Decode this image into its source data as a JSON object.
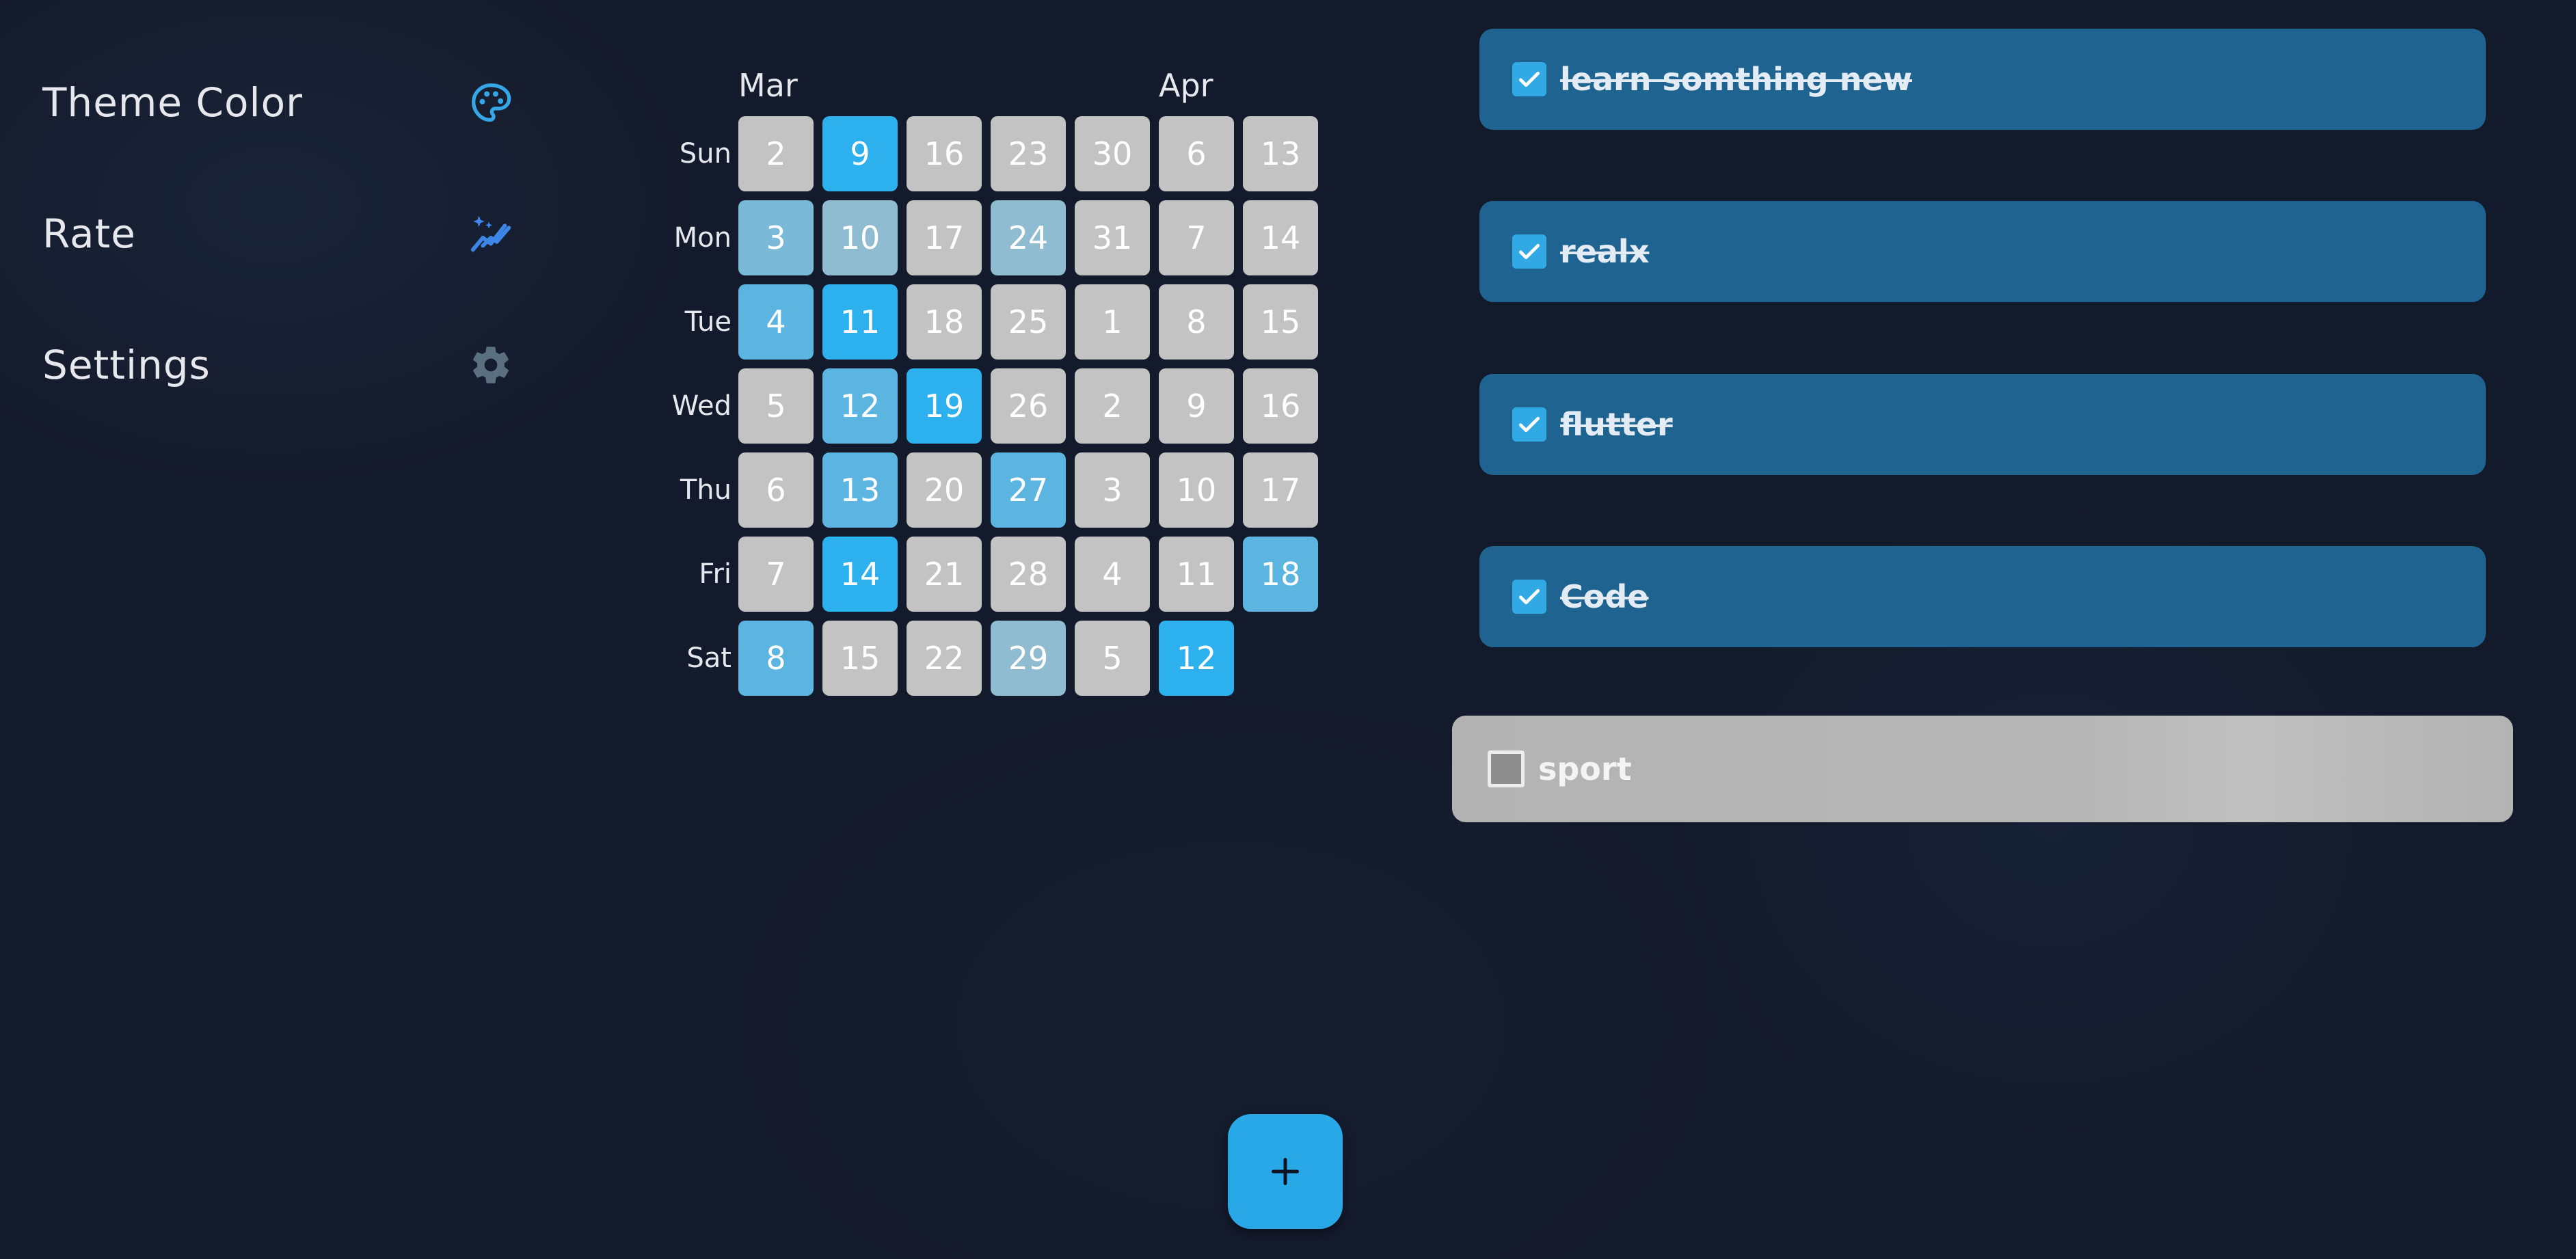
{
  "menu": {
    "items": [
      {
        "label": "Theme Color",
        "icon": "palette-icon"
      },
      {
        "label": "Rate",
        "icon": "sparkle-chart-icon"
      },
      {
        "label": "Settings",
        "icon": "gear-icon"
      }
    ]
  },
  "heatmap": {
    "months": [
      "Mar",
      "Apr"
    ],
    "weekdays": [
      "Sun",
      "Mon",
      "Tue",
      "Wed",
      "Thu",
      "Fri",
      "Sat"
    ],
    "colors": {
      "empty": "#c3c3c3",
      "l1": "#8fbcd0",
      "l2": "#7bb9d8",
      "l3": "#5cb5e0",
      "l4": "#2db1ee"
    },
    "weeks": [
      [
        {
          "d": "2",
          "l": "empty"
        },
        {
          "d": "3",
          "l": "l2"
        },
        {
          "d": "4",
          "l": "l3"
        },
        {
          "d": "5",
          "l": "empty"
        },
        {
          "d": "6",
          "l": "empty"
        },
        {
          "d": "7",
          "l": "empty"
        },
        {
          "d": "8",
          "l": "l3"
        }
      ],
      [
        {
          "d": "9",
          "l": "l4"
        },
        {
          "d": "10",
          "l": "l1"
        },
        {
          "d": "11",
          "l": "l4"
        },
        {
          "d": "12",
          "l": "l3"
        },
        {
          "d": "13",
          "l": "l3"
        },
        {
          "d": "14",
          "l": "l4"
        },
        {
          "d": "15",
          "l": "empty"
        }
      ],
      [
        {
          "d": "16",
          "l": "empty"
        },
        {
          "d": "17",
          "l": "empty"
        },
        {
          "d": "18",
          "l": "empty"
        },
        {
          "d": "19",
          "l": "l4"
        },
        {
          "d": "20",
          "l": "empty"
        },
        {
          "d": "21",
          "l": "empty"
        },
        {
          "d": "22",
          "l": "empty"
        }
      ],
      [
        {
          "d": "23",
          "l": "empty"
        },
        {
          "d": "24",
          "l": "l1"
        },
        {
          "d": "25",
          "l": "empty"
        },
        {
          "d": "26",
          "l": "empty"
        },
        {
          "d": "27",
          "l": "l3"
        },
        {
          "d": "28",
          "l": "empty"
        },
        {
          "d": "29",
          "l": "l1"
        }
      ],
      [
        {
          "d": "30",
          "l": "empty"
        },
        {
          "d": "31",
          "l": "empty"
        },
        {
          "d": "1",
          "l": "empty"
        },
        {
          "d": "2",
          "l": "empty"
        },
        {
          "d": "3",
          "l": "empty"
        },
        {
          "d": "4",
          "l": "empty"
        },
        {
          "d": "5",
          "l": "empty"
        }
      ],
      [
        {
          "d": "6",
          "l": "empty"
        },
        {
          "d": "7",
          "l": "empty"
        },
        {
          "d": "8",
          "l": "empty"
        },
        {
          "d": "9",
          "l": "empty"
        },
        {
          "d": "10",
          "l": "empty"
        },
        {
          "d": "11",
          "l": "empty"
        },
        {
          "d": "12",
          "l": "l4"
        }
      ],
      [
        {
          "d": "13",
          "l": "empty"
        },
        {
          "d": "14",
          "l": "empty"
        },
        {
          "d": "15",
          "l": "empty"
        },
        {
          "d": "16",
          "l": "empty"
        },
        {
          "d": "17",
          "l": "empty"
        },
        {
          "d": "18",
          "l": "l3"
        }
      ]
    ]
  },
  "tasks": [
    {
      "label": "learn somthing new",
      "done": true
    },
    {
      "label": "realx",
      "done": true
    },
    {
      "label": "flutter",
      "done": true
    },
    {
      "label": "Code",
      "done": true
    },
    {
      "label": "sport",
      "done": false
    }
  ],
  "fab": {
    "icon": "plus-icon"
  }
}
